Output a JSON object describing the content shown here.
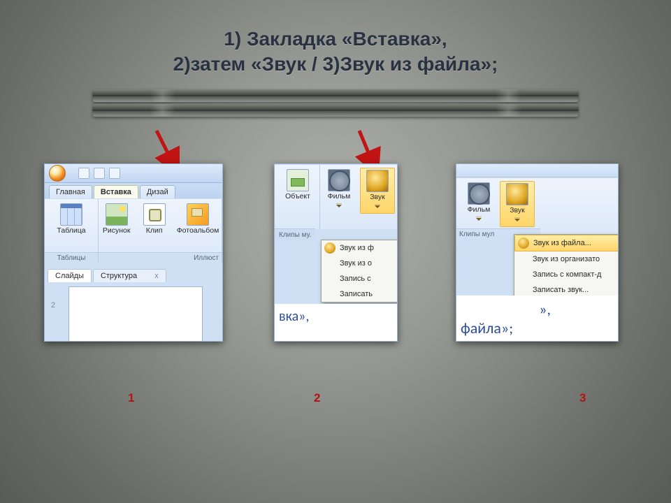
{
  "title_line1": "1) Закладка «Вставка»,",
  "title_line2": "2)затем  «Звук / 3)Звук из файла»;",
  "step_labels": {
    "one": "1",
    "two": "2",
    "three": "3"
  },
  "panel1": {
    "tabs": {
      "home": "Главная",
      "insert": "Вставка",
      "design": "Дизай"
    },
    "btn_table": "Таблица",
    "btn_picture": "Рисунок",
    "btn_clip": "Клип",
    "btn_album": "Фотоальбом",
    "group_tables": "Таблицы",
    "group_illust": "Иллюст",
    "nav_slides": "Слайды",
    "nav_outline": "Структура",
    "nav_close": "x",
    "slide_index": "2"
  },
  "panel2": {
    "btn_object": "Объект",
    "btn_movie": "Фильм",
    "btn_sound": "Звук",
    "group_media": "Клипы му.",
    "menu": [
      "Звук из ф",
      "Звук из о",
      "Запись с",
      "Записать"
    ],
    "frag": "вка»,"
  },
  "panel3": {
    "btn_movie": "Фильм",
    "btn_sound": "Звук",
    "group_media": "Клипы мул",
    "menu": [
      "Звук из файла...",
      "Звук из организато",
      "Запись с компакт-д",
      "Записать звук..."
    ],
    "frag1": "»,",
    "frag2": "файла»;"
  }
}
